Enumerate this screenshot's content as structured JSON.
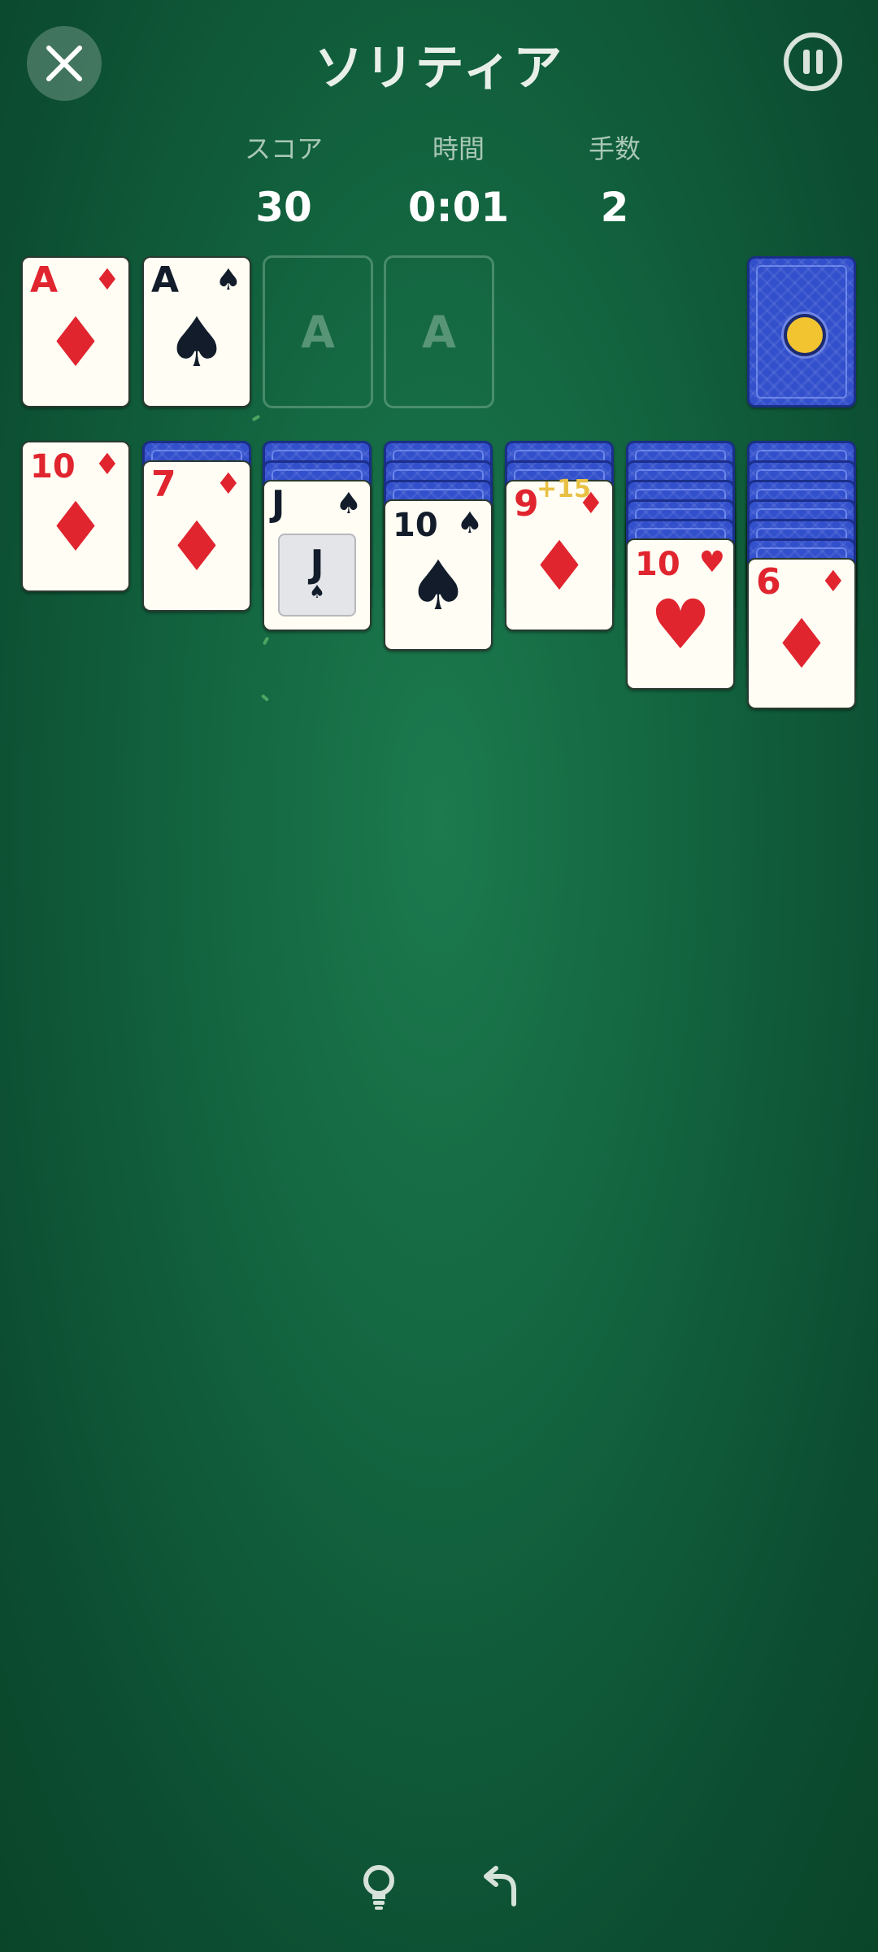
{
  "header": {
    "title": "ソリティア",
    "close_icon": "close-x-icon",
    "pause_icon": "pause-icon"
  },
  "stats": {
    "score_label": "スコア",
    "score_value": "30",
    "time_label": "時間",
    "time_value": "0:01",
    "moves_label": "手数",
    "moves_value": "2"
  },
  "foundations": {
    "card1": {
      "rank": "A",
      "suit": "♦"
    },
    "card2": {
      "rank": "A",
      "suit": "♠"
    },
    "empty_slot_label": "A"
  },
  "tableau": {
    "col1": {
      "rank": "10",
      "suit": "♦"
    },
    "col2": {
      "rank": "7",
      "suit": "♦"
    },
    "col3": {
      "rank": "J",
      "suit": "♠"
    },
    "col4": {
      "rank": "10",
      "suit": "♠"
    },
    "col5": {
      "rank": "9",
      "suit": "♦"
    },
    "col6": {
      "rank": "10",
      "suit": "♥"
    },
    "col7": {
      "rank": "6",
      "suit": "♦"
    }
  },
  "popup": "+15",
  "colors": {
    "felt": "#136540",
    "card_back": "#3350cc",
    "red_suit": "#e0252f",
    "black_suit": "#121c2a",
    "popup": "#e8c043"
  },
  "controls": {
    "hint_icon": "lightbulb-icon",
    "undo_icon": "undo-arrow-icon"
  }
}
